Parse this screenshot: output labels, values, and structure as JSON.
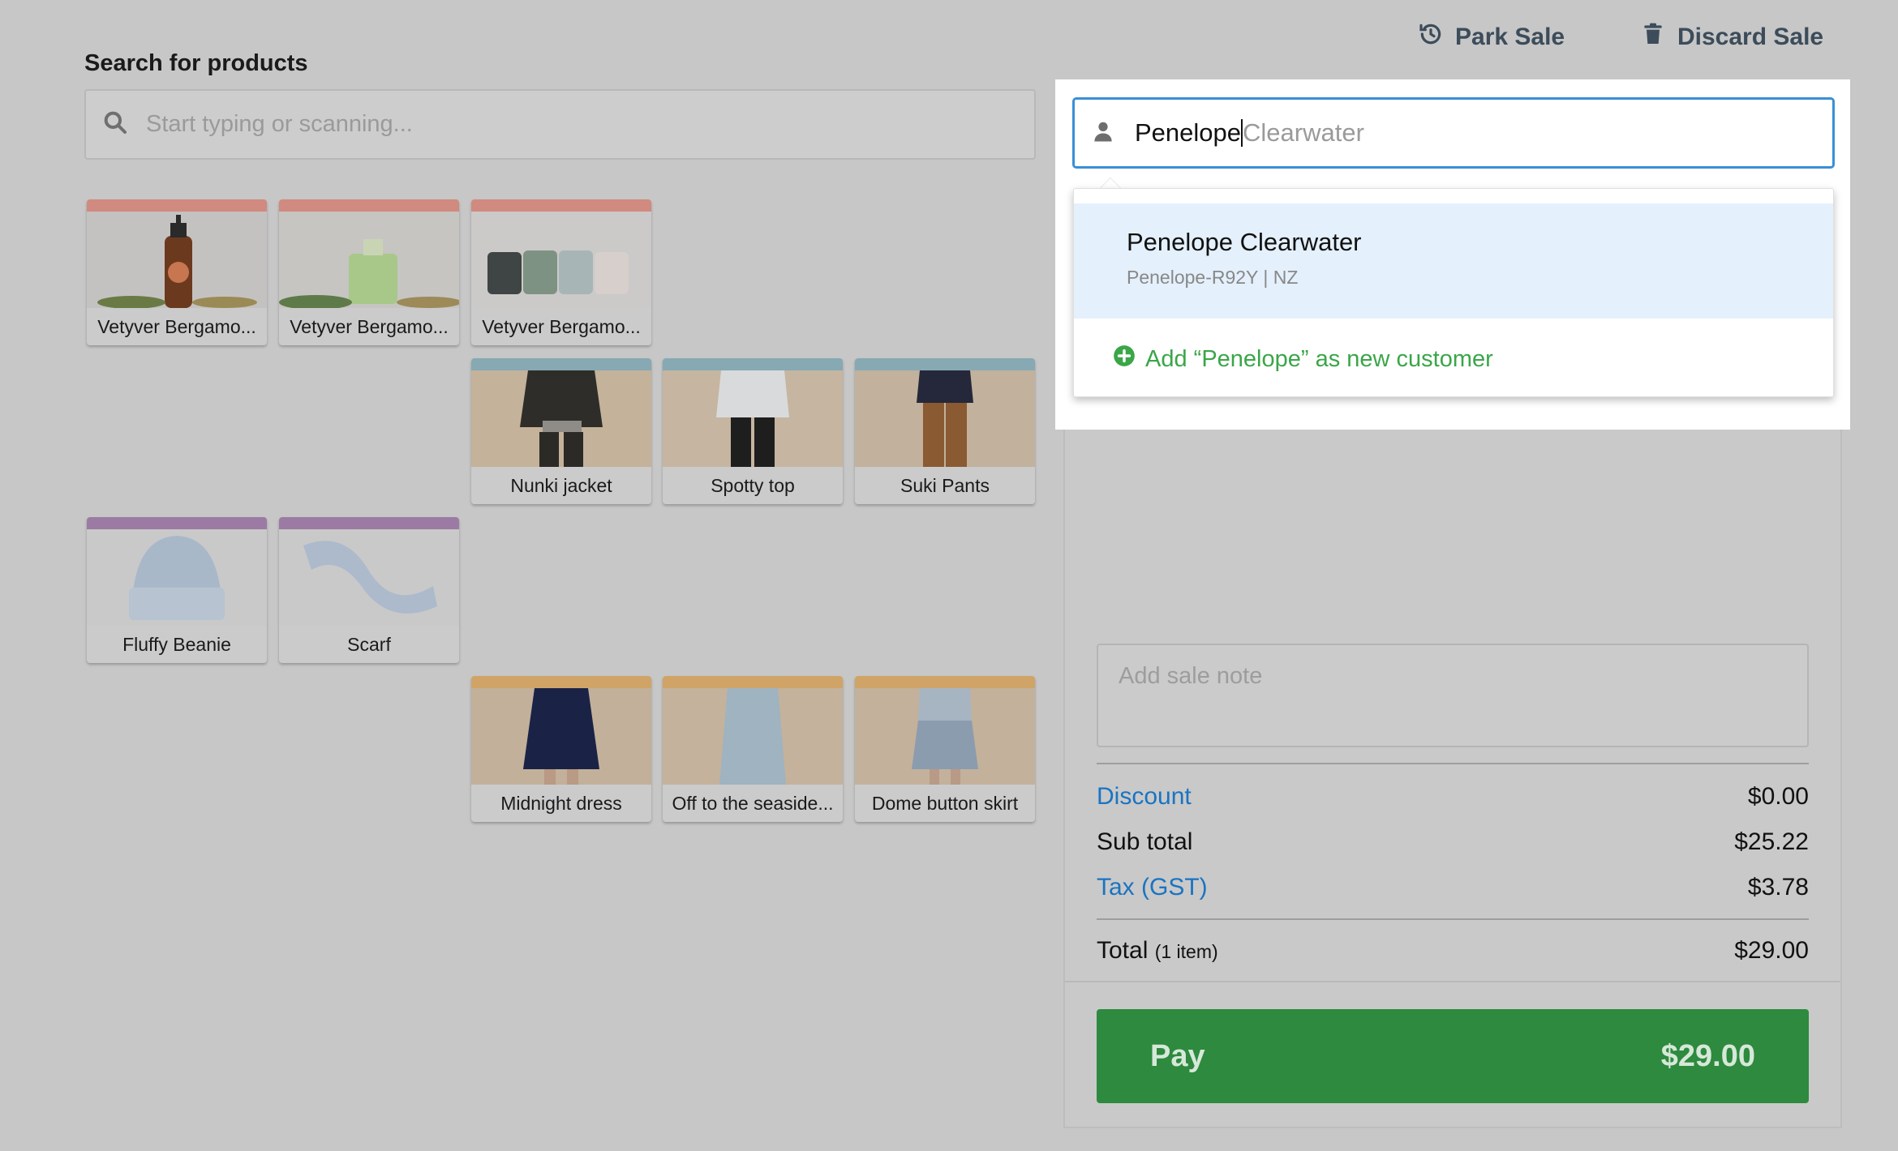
{
  "header": {
    "park_sale_label": "Park Sale",
    "discard_sale_label": "Discard Sale"
  },
  "product_search": {
    "title": "Search for products",
    "placeholder": "Start typing or scanning..."
  },
  "products": [
    {
      "name": "Vetyver Bergamo...",
      "group_color": "#d18a7f",
      "image": "soap-bottle"
    },
    {
      "name": "Vetyver Bergamo...",
      "group_color": "#d18a7f",
      "image": "perfume-bottle"
    },
    {
      "name": "Vetyver Bergamo...",
      "group_color": "#d18a7f",
      "image": "candle-cups"
    },
    {
      "name": "Nunki jacket",
      "group_color": "#86a9b3",
      "image": "model-jacket"
    },
    {
      "name": "Spotty top",
      "group_color": "#86a9b3",
      "image": "model-top"
    },
    {
      "name": "Suki Pants",
      "group_color": "#86a9b3",
      "image": "model-pants"
    },
    {
      "name": "Fluffy Beanie",
      "group_color": "#9b7ba3",
      "image": "beanie"
    },
    {
      "name": "Scarf",
      "group_color": "#9b7ba3",
      "image": "scarf"
    },
    {
      "name": "Midnight dress",
      "group_color": "#d0a467",
      "image": "model-dress"
    },
    {
      "name": "Off to the seaside...",
      "group_color": "#d0a467",
      "image": "model-seaside"
    },
    {
      "name": "Dome button skirt",
      "group_color": "#d0a467",
      "image": "model-skirt"
    }
  ],
  "customer_search": {
    "typed": "Penelope",
    "autocomplete": "Clearwater",
    "suggestion": {
      "name": "Penelope Clearwater",
      "meta": "Penelope-R92Y | NZ"
    },
    "add_new_label": "Add “Penelope” as new customer"
  },
  "sale": {
    "note_placeholder": "Add sale note",
    "discount_label": "Discount",
    "discount_value": "$0.00",
    "subtotal_label": "Sub total",
    "subtotal_value": "$25.22",
    "tax_label": "Tax (GST)",
    "tax_value": "$3.78",
    "total_label": "Total",
    "total_items": "(1 item)",
    "total_value": "$29.00",
    "pay_label": "Pay",
    "pay_amount": "$29.00"
  },
  "colors": {
    "accent_blue": "#1a74c2",
    "pay_green": "#2d8a3e",
    "add_green": "#3aa648",
    "input_focus": "#3a8fd6"
  }
}
